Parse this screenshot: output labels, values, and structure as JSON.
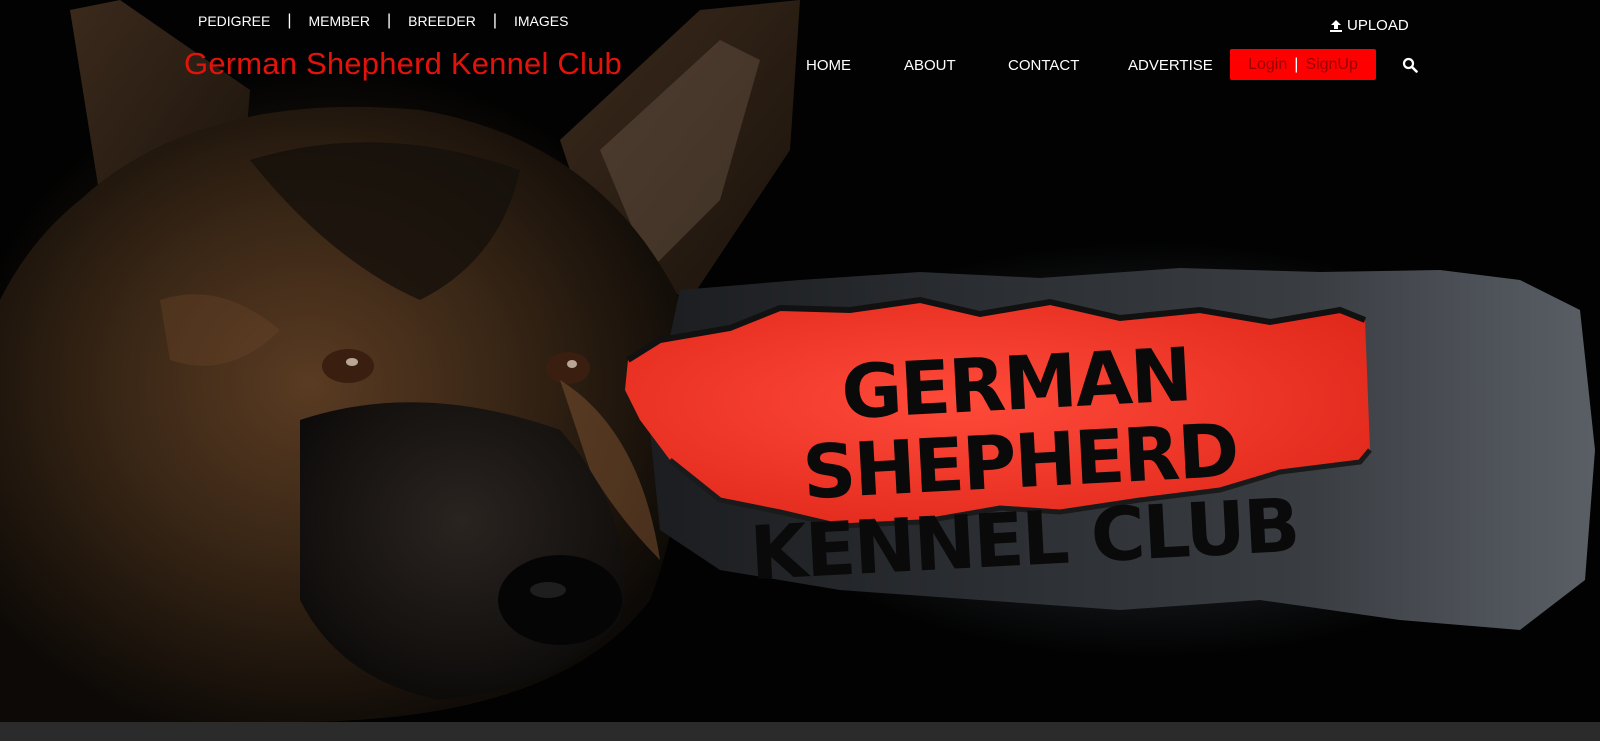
{
  "top_links": {
    "pedigree": "PEDIGREE",
    "member": "MEMBER",
    "breeder": "BREEDER",
    "images": "IMAGES",
    "separator": "|"
  },
  "logo_text": "German Shepherd Kennel Club",
  "upload_label": "UPLOAD",
  "nav": {
    "home": "HOME",
    "about": "ABOUT",
    "contact": "CONTACT",
    "advertise": "ADVERTISE"
  },
  "auth": {
    "login": "Login",
    "separator": "|",
    "signup": "SignUp"
  },
  "hero": {
    "line1": "GERMAN SHEPHERD",
    "line2": "KENNEL CLUB"
  },
  "icons": {
    "upload": "upload-icon",
    "search": "search-icon"
  },
  "colors": {
    "brand_red": "#e3120b",
    "auth_bg": "#ff0000",
    "banner_red": "#f23a2a"
  }
}
